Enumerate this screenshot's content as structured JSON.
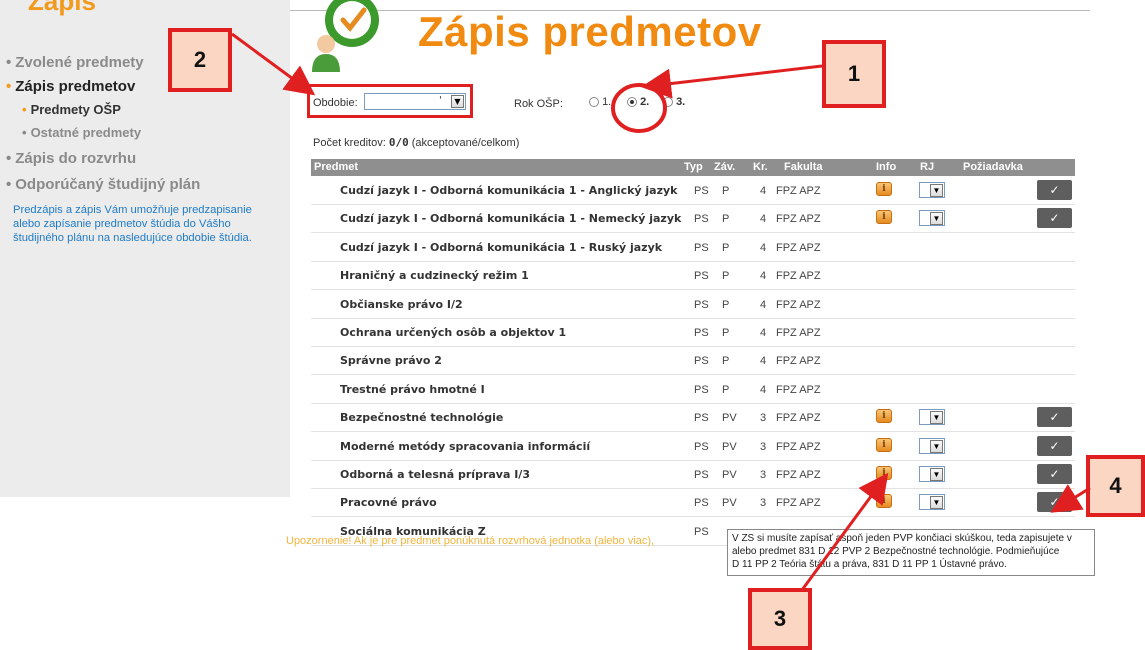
{
  "sidebar": {
    "section_title": "Zápis",
    "items": [
      {
        "label": "Zvolené predmety",
        "level": "main",
        "active": false
      },
      {
        "label": "Zápis predmetov",
        "level": "main",
        "active": true
      },
      {
        "label": "Predmety OŠP",
        "level": "sub",
        "active": true
      },
      {
        "label": "Ostatné predmety",
        "level": "sub",
        "active": false
      },
      {
        "label": "Zápis do rozvrhu",
        "level": "main",
        "active": false
      },
      {
        "label": "Odporúčaný študijný plán",
        "level": "main",
        "active": false
      }
    ],
    "info_text_lines": [
      "Predzápis a zápis Vám umožňuje predzapisanie",
      "alebo zapísanie predmetov štúdia do Vášho",
      "študijného plánu na nasledujúce obdobie štúdia."
    ]
  },
  "header": {
    "title": "Zápis predmetov",
    "logo_icon": "clock-person-icon"
  },
  "filters": {
    "obdobie_label": "Obdobie:",
    "obdobie_value": "'",
    "rok_label": "Rok OŠP:",
    "rok_options": [
      "1.",
      "2.",
      "3."
    ],
    "rok_selected": "2."
  },
  "kredity": {
    "label": "Počet kreditov:",
    "value": "0/0",
    "note": "(akceptované/celkom)"
  },
  "table": {
    "columns": [
      "Predmet",
      "Typ",
      "Záv.",
      "Kr.",
      "Fakulta",
      "Info",
      "RJ",
      "Požiadavka"
    ],
    "rows": [
      {
        "predmet": "Cudzí jazyk I - Odborná komunikácia 1 - Anglický jazyk",
        "typ": "PS",
        "zav": "P",
        "kr": "4",
        "fakulta": "FPZ APZ",
        "info": true,
        "rj": true,
        "action": true
      },
      {
        "predmet": "Cudzí jazyk I - Odborná komunikácia 1 - Nemecký jazyk",
        "typ": "PS",
        "zav": "P",
        "kr": "4",
        "fakulta": "FPZ APZ",
        "info": true,
        "rj": true,
        "action": true
      },
      {
        "predmet": "Cudzí jazyk I - Odborná komunikácia 1 - Ruský jazyk",
        "typ": "PS",
        "zav": "P",
        "kr": "4",
        "fakulta": "FPZ APZ",
        "info": false,
        "rj": false,
        "action": false
      },
      {
        "predmet": "Hraničný a cudzinecký režim 1",
        "typ": "PS",
        "zav": "P",
        "kr": "4",
        "fakulta": "FPZ APZ",
        "info": false,
        "rj": false,
        "action": false
      },
      {
        "predmet": "Občianske právo I/2",
        "typ": "PS",
        "zav": "P",
        "kr": "4",
        "fakulta": "FPZ APZ",
        "info": false,
        "rj": false,
        "action": false
      },
      {
        "predmet": "Ochrana určených osôb a objektov 1",
        "typ": "PS",
        "zav": "P",
        "kr": "4",
        "fakulta": "FPZ APZ",
        "info": false,
        "rj": false,
        "action": false
      },
      {
        "predmet": "Správne právo 2",
        "typ": "PS",
        "zav": "P",
        "kr": "4",
        "fakulta": "FPZ APZ",
        "info": false,
        "rj": false,
        "action": false
      },
      {
        "predmet": "Trestné právo hmotné I",
        "typ": "PS",
        "zav": "P",
        "kr": "4",
        "fakulta": "FPZ APZ",
        "info": false,
        "rj": false,
        "action": false
      },
      {
        "predmet": "Bezpečnostné technológie",
        "typ": "PS",
        "zav": "PV",
        "kr": "3",
        "fakulta": "FPZ APZ",
        "info": true,
        "rj": true,
        "action": true
      },
      {
        "predmet": "Moderné metódy spracovania informácií",
        "typ": "PS",
        "zav": "PV",
        "kr": "3",
        "fakulta": "FPZ APZ",
        "info": true,
        "rj": true,
        "action": true
      },
      {
        "predmet": "Odborná a telesná príprava I/3",
        "typ": "PS",
        "zav": "PV",
        "kr": "3",
        "fakulta": "FPZ APZ",
        "info": true,
        "rj": true,
        "action": true
      },
      {
        "predmet": "Pracovné právo",
        "typ": "PS",
        "zav": "PV",
        "kr": "3",
        "fakulta": "FPZ APZ",
        "info": true,
        "rj": true,
        "action": true
      },
      {
        "predmet": "Sociálna komunikácia Z",
        "typ": "PS",
        "zav": "",
        "kr": "",
        "fakulta": "",
        "info": false,
        "rj": false,
        "action": false
      }
    ]
  },
  "tooltip": {
    "lines": [
      "V ZS si musíte zapísať aspoň jeden PVP končiaci skúškou, teda zapisujete v",
      "alebo predmet 831 D 12 PVP 2 Bezpečnostné technológie. Podmieňujúce",
      "D 11 PP 2 Teória štátu a práva, 831 D 11 PP 1 Ústavné právo."
    ]
  },
  "warning": "Upozornenie! Ak je pre predmet ponúknutá rozvrhová jednotka (alebo viac),",
  "callouts": [
    "1",
    "2",
    "3",
    "4"
  ],
  "colors": {
    "accent_orange": "#f08a10",
    "annotation_red": "#e02020",
    "annotation_fill": "#fbd6c2",
    "table_header": "#8f8f8f",
    "sidebar_bg": "#ececec",
    "info_link_blue": "#1f7bc7"
  }
}
